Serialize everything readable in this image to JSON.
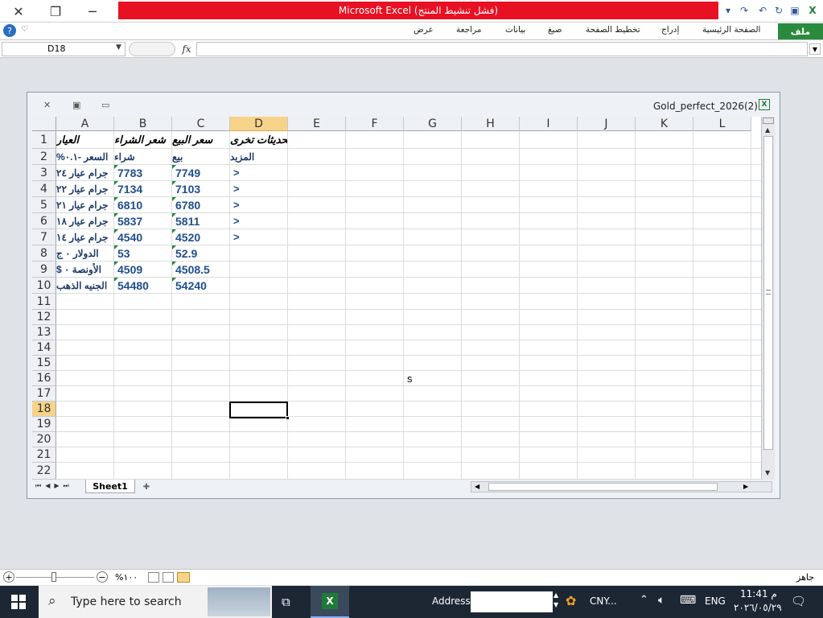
{
  "window": {
    "title": "Microsoft Excel (فشل تنشيط المنتج)"
  },
  "ribbon": {
    "file_tab": "ملف",
    "tabs": [
      "الصفحة الرئيسية",
      "إدراج",
      "تخطيط الصفحة",
      "صيغ",
      "بيانات",
      "مراجعة",
      "عرض"
    ]
  },
  "formula_bar": {
    "name_box": "D18",
    "fx": "fx",
    "formula": ""
  },
  "workbook": {
    "name": "Gold_perfect_2026(2)",
    "sheet_tab": "Sheet1",
    "columns": [
      "A",
      "B",
      "C",
      "D",
      "E",
      "F",
      "G",
      "H",
      "I",
      "J",
      "K",
      "L"
    ],
    "selected_column": "D",
    "rows": [
      "1",
      "2",
      "3",
      "4",
      "5",
      "6",
      "7",
      "8",
      "9",
      "10",
      "11",
      "12",
      "13",
      "14",
      "15",
      "16",
      "17",
      "18",
      "19",
      "20",
      "21",
      "22"
    ],
    "selected_row": "18",
    "cells": {
      "A1": "العيار",
      "B1": "شعر الشراء",
      "C1": "سعر البيع",
      "D1": "تحديثات تخرى",
      "A2": "السعر -٠.١%",
      "B2": "شراء",
      "C2": "بيع",
      "D2": "المزيد",
      "A3": "جرام عيار ٢٤",
      "B3": "7783",
      "C3": "7749",
      "D3": ">",
      "A4": "جرام عيار ٢٢",
      "B4": "7134",
      "C4": "7103",
      "D4": ">",
      "A5": "جرام عيار ٢١",
      "B5": "6810",
      "C5": "6780",
      "D5": ">",
      "A6": "جرام عيار ١٨",
      "B6": "5837",
      "C6": "5811",
      "D6": ">",
      "A7": "جرام عيار ١٤",
      "B7": "4540",
      "C7": "4520",
      "D7": ">",
      "A8": "الدولار ٠ ج",
      "B8": "53",
      "C8": "52.9",
      "A9": "الأونصة ٠ $",
      "B9": "4509",
      "C9": "4508.5",
      "A10": "الجنيه الذهب",
      "B10": "54480",
      "C10": "54240",
      "G16": "s"
    }
  },
  "status_bar": {
    "ready": "جاهز",
    "zoom": "%١٠٠"
  },
  "taskbar": {
    "search_placeholder": "Type here to search",
    "address_label": "Address",
    "currency": "CNY...",
    "language": "ENG",
    "time": "11:41 م",
    "date": "٢٠٢٦/٠٥/٢٩"
  },
  "colors": {
    "accent_red": "#e81123",
    "file_tab_green": "#2a8a3e",
    "selected_header": "#f7d38a",
    "number_blue": "#1f4e8c"
  }
}
